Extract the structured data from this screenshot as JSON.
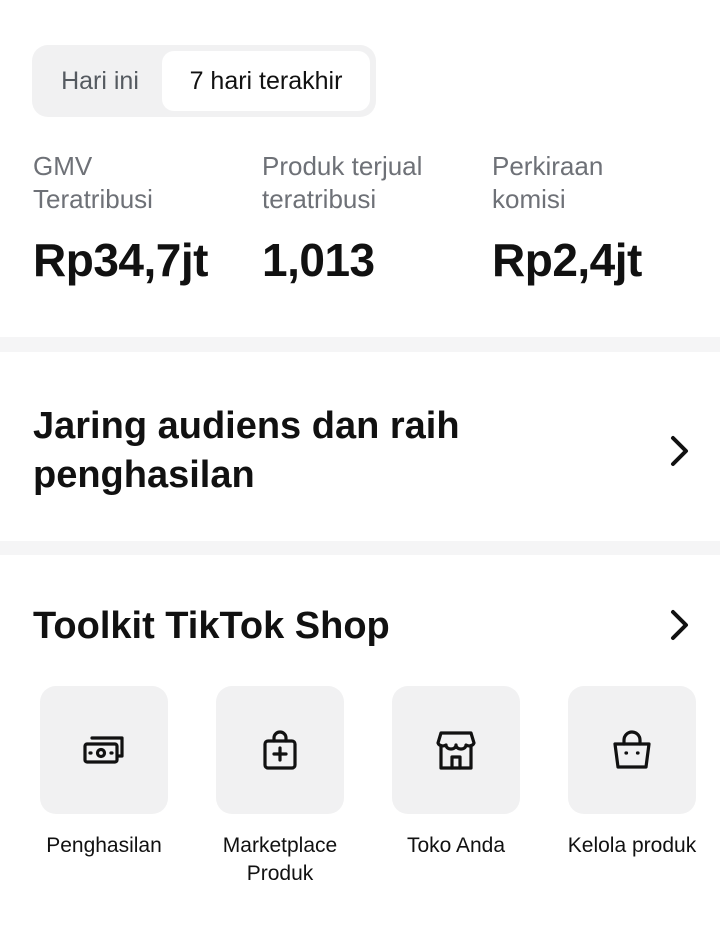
{
  "period_tabs": [
    {
      "label": "Hari ini",
      "selected": false
    },
    {
      "label": "7 hari terakhir",
      "selected": true
    }
  ],
  "stats": [
    {
      "label_line1": "GMV",
      "label_line2": "Teratribusi",
      "value": "Rp34,7jt"
    },
    {
      "label_line1": "Produk terjual",
      "label_line2": "teratribusi",
      "value": "1,013"
    },
    {
      "label_line1": "Perkiraan",
      "label_line2": "komisi",
      "value": "Rp2,4jt"
    }
  ],
  "promo": {
    "line1": "Jaring audiens dan raih",
    "line2": "penghasilan"
  },
  "toolkit": {
    "title": "Toolkit TikTok Shop",
    "tools": [
      {
        "label": "Penghasilan",
        "icon": "money-icon"
      },
      {
        "label_line1": "Marketplace",
        "label_line2": "Produk",
        "icon": "shopping-bag-plus-icon"
      },
      {
        "label": "Toko Anda",
        "icon": "store-icon"
      },
      {
        "label": "Kelola produk",
        "icon": "basket-icon"
      }
    ]
  },
  "colors": {
    "text": "#111111",
    "muted": "#6e7177",
    "tile_bg": "#f1f1f2",
    "divider": "#f5f5f6"
  }
}
